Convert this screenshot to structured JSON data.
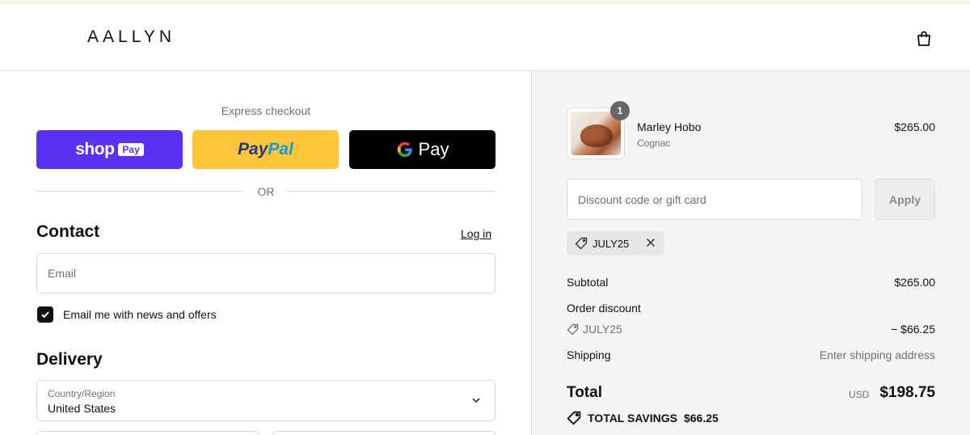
{
  "brand": {
    "logo": "AALLYN"
  },
  "express": {
    "label": "Express checkout",
    "shop_pay": {
      "word": "shop",
      "badge": "Pay"
    },
    "paypal": {
      "part1": "Pay",
      "part2": "Pal"
    },
    "google_pay": {
      "g": "G",
      "word": "Pay"
    },
    "or_label": "OR"
  },
  "contact": {
    "title": "Contact",
    "login_label": "Log in",
    "email_placeholder": "Email",
    "newsletter_label": "Email me with news and offers",
    "newsletter_checked": true
  },
  "delivery": {
    "title": "Delivery",
    "country_label": "Country/Region",
    "country_value": "United States"
  },
  "order": {
    "item": {
      "name": "Marley Hobo",
      "variant": "Cognac",
      "price": "$265.00",
      "quantity": "1"
    },
    "discount_placeholder": "Discount code or gift card",
    "apply_label": "Apply",
    "applied_code": "JULY25",
    "subtotal_label": "Subtotal",
    "subtotal_value": "$265.00",
    "order_discount_label": "Order discount",
    "discount_code": "JULY25",
    "discount_value": "− $66.25",
    "shipping_label": "Shipping",
    "shipping_value": "Enter shipping address",
    "total_label": "Total",
    "currency": "USD",
    "total_value": "$198.75",
    "savings_label": "TOTAL SAVINGS",
    "savings_value": "$66.25"
  },
  "colors": {
    "shop_pay": "#5a31f4",
    "paypal": "#ffc439",
    "google_pay": "#000000",
    "summary_bg": "#f5f5f5"
  }
}
